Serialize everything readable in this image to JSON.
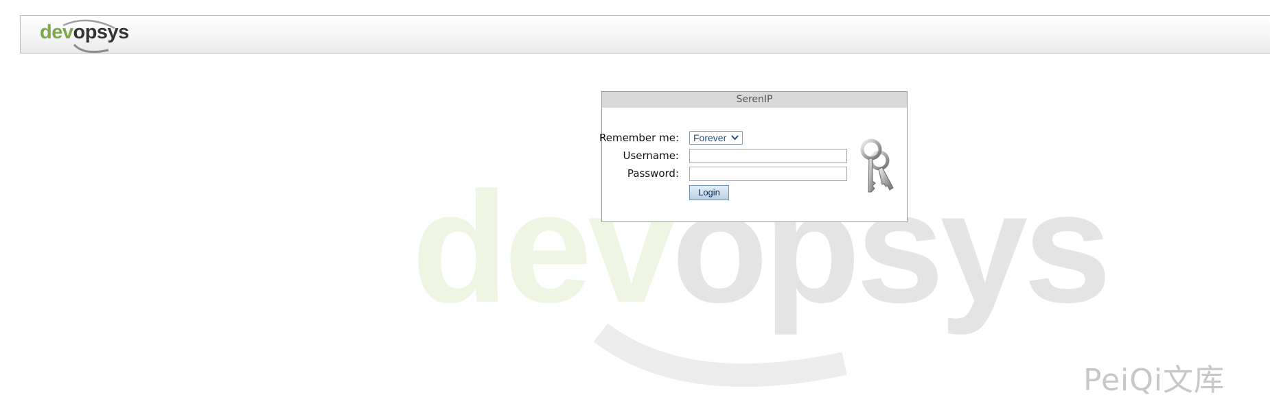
{
  "header": {
    "logo_prefix": "dev",
    "logo_suffix": "opsys",
    "logo_colors": {
      "green": "#7ea84a",
      "grey": "#333333"
    }
  },
  "login": {
    "title": "SerenIP",
    "remember_label": "Remember me:",
    "remember_value": "Forever",
    "username_label": "Username:",
    "username_value": "",
    "password_label": "Password:",
    "password_value": "",
    "button_label": "Login"
  },
  "watermark": {
    "text_prefix": "dev",
    "text_suffix": "opsys",
    "colors": {
      "green": "#eef5e2",
      "grey": "#e4e4e4"
    }
  },
  "site_watermark": "PeiQi文库",
  "icons": [
    "keys-icon",
    "chevron-down-icon",
    "logo-swoosh-icon"
  ]
}
